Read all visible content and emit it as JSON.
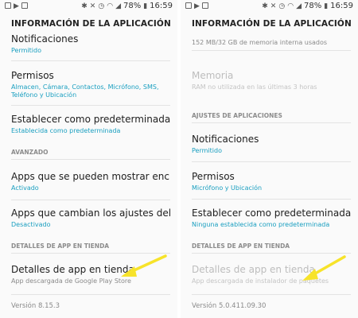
{
  "status": {
    "battery": "78%",
    "time": "16:59",
    "left_icons": [
      "notification-icon",
      "play-icon",
      "gallery-icon"
    ],
    "right_icons": [
      "bluetooth-icon",
      "mute-icon",
      "alarm-icon",
      "wifi-icon",
      "signal-icon"
    ]
  },
  "left": {
    "title": "INFORMACIÓN DE LA APLICACIÓN",
    "notifications": {
      "title": "Notificaciones",
      "sub": "Permitido"
    },
    "permissions": {
      "title": "Permisos",
      "sub1": "Almacen, Cámara, Contactos, Micrófono, SMS,",
      "sub2": "Teléfono y Ubicación"
    },
    "default": {
      "title": "Establecer como predeterminada",
      "sub": "Establecida como predeterminada"
    },
    "section_advanced": "AVANZADO",
    "overlay": {
      "title": "Apps que se pueden mostrar encima",
      "sub": "Activado"
    },
    "system_settings": {
      "title": "Apps que cambian los ajustes del siste..",
      "sub": "Desactivado"
    },
    "section_store": "DETALLES DE APP EN TIENDA",
    "store": {
      "title": "Detalles de app en tienda",
      "sub": "App descargada de Google Play Store"
    },
    "version": "Versión 8.15.3"
  },
  "right": {
    "title": "INFORMACIÓN DE LA APLICACIÓN",
    "storage_sub": "152 MB/32 GB de memoria interna usados",
    "memory": {
      "title": "Memoria",
      "sub": "RAM no utilizada en las últimas 3 horas"
    },
    "section_app_settings": "AJUSTES DE APLICACIONES",
    "notifications": {
      "title": "Notificaciones",
      "sub": "Permitido"
    },
    "permissions": {
      "title": "Permisos",
      "sub": "Micrófono y Ubicación"
    },
    "default": {
      "title": "Establecer como predeterminada",
      "sub": "Ninguna establecida como predeterminada"
    },
    "section_store": "DETALLES DE APP EN TIENDA",
    "store": {
      "title": "Detalles de app en tienda",
      "sub": "App descargada de instalador de paquetes"
    },
    "version": "Versión 5.0.411.09.30"
  },
  "colors": {
    "accent": "#1a9fc0",
    "arrow": "#f7e32a",
    "section": "#8c8c8c",
    "disabled": "#bdbdbd"
  }
}
